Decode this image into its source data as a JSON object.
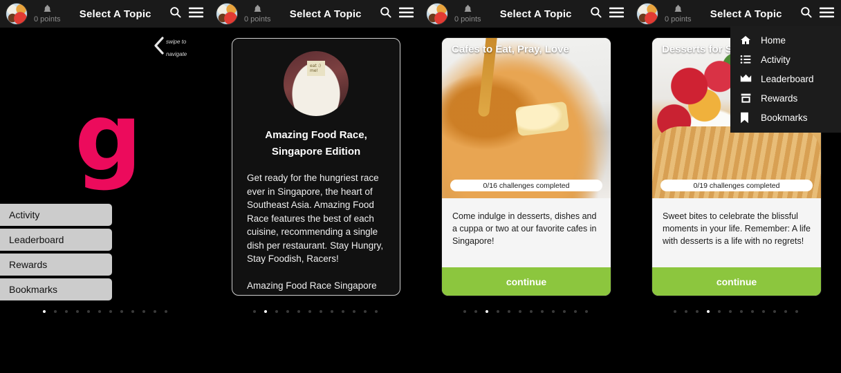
{
  "header": {
    "title": "Select A Topic",
    "points": "0 points",
    "avatar_icon": "food-avatar-icon",
    "bell_icon": "bell-icon",
    "search_icon": "search-icon",
    "menu_icon": "hamburger-menu-icon"
  },
  "panel1": {
    "swipe_hint_line1": "swipe to",
    "swipe_hint_line2": "navigate",
    "logo": "g",
    "logo_color": "#ec0b5c",
    "side_menu": [
      {
        "label": "Activity"
      },
      {
        "label": "Leaderboard"
      },
      {
        "label": "Rewards"
      },
      {
        "label": "Bookmarks"
      }
    ],
    "dots": {
      "count": 12,
      "active": 0
    }
  },
  "panel2": {
    "card": {
      "thumb_icon": "eat-me-dessert-photo",
      "thumb_note_line1": "eat :)",
      "thumb_note_line2": "me!",
      "title_line1": "Amazing Food Race,",
      "title_line2": "Singapore Edition",
      "paragraph1": "Get ready for the hungriest race ever in Singapore, the heart of Southeast Asia. Amazing Food Race features the best of each cuisine, recommending a single dish per restaurant. Stay Hungry, Stay Foodish, Racers!",
      "paragraph2": "Amazing Food Race Singapore"
    },
    "dots": {
      "count": 12,
      "active": 1
    }
  },
  "panel3": {
    "card": {
      "title": "Cafes to Eat, Pray, Love",
      "photo_icon": "pancake-syrup-photo",
      "progress": "0/16 challenges completed",
      "caption": "Come indulge in desserts, dishes and a cuppa or two at our favorite cafes in Singapore!",
      "continue_label": "continue",
      "continue_color": "#8cc63e"
    },
    "dots": {
      "count": 12,
      "active": 2
    }
  },
  "panel4": {
    "card": {
      "title": "Desserts for S",
      "photo_icon": "berry-tart-photo",
      "progress": "0/19 challenges completed",
      "caption": "Sweet bites to celebrate the blissful moments in your life. Remember: A life with desserts is a life with no regrets!",
      "continue_label": "continue",
      "continue_color": "#8cc63e"
    },
    "dots": {
      "count": 12,
      "active": 3
    }
  },
  "dropdown": {
    "items": [
      {
        "label": "Home",
        "icon": "home-icon"
      },
      {
        "label": "Activity",
        "icon": "list-icon"
      },
      {
        "label": "Leaderboard",
        "icon": "crown-icon"
      },
      {
        "label": "Rewards",
        "icon": "store-icon"
      },
      {
        "label": "Bookmarks",
        "icon": "bookmark-icon"
      }
    ]
  }
}
